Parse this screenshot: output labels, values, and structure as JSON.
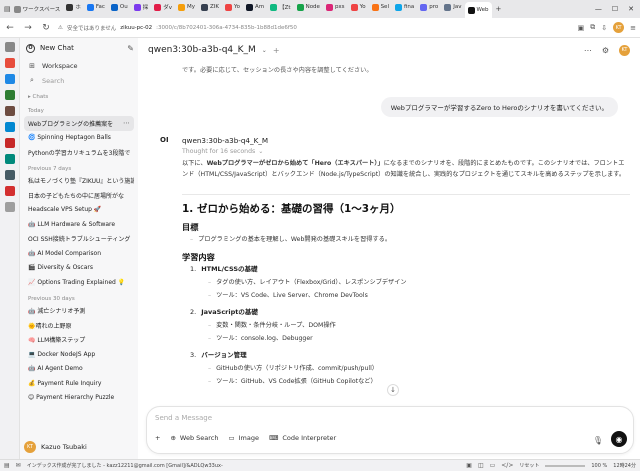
{
  "browser": {
    "workspace_label": "ワークスペース",
    "tabs": [
      {
        "label": "ホ",
        "color": "#333333"
      },
      {
        "label": "Fac",
        "color": "#1877f2"
      },
      {
        "label": "Ou",
        "color": "#0a64c8"
      },
      {
        "label": "採",
        "color": "#7c3aed"
      },
      {
        "label": "ダv",
        "color": "#e11d48"
      },
      {
        "label": "My",
        "color": "#f59e0b"
      },
      {
        "label": "ZIK",
        "color": "#374151"
      },
      {
        "label": "Yo",
        "color": "#ef4444"
      },
      {
        "label": "Am",
        "color": "#111827"
      },
      {
        "label": "【Zt",
        "color": "#10b981"
      },
      {
        "label": "Node",
        "color": "#16a34a"
      },
      {
        "label": "pxs",
        "color": "#db2777"
      },
      {
        "label": "Yo",
        "color": "#ef4444"
      },
      {
        "label": "Sel",
        "color": "#f97316"
      },
      {
        "label": "fina",
        "color": "#0ea5e9"
      },
      {
        "label": "pro",
        "color": "#6366f1"
      },
      {
        "label": "Jav",
        "color": "#64748b"
      },
      {
        "label": "Web",
        "color": "#111111",
        "active": true
      }
    ],
    "url_security": "安全ではありません",
    "url_host": "zikuu-pc-02",
    "url_path": ":3000/c/8b702401-306a-4734-835b-1b88d1de6f50",
    "profile_initials": "KT"
  },
  "sidebar": {
    "new_chat": "New Chat",
    "workspace": "Workspace",
    "search_placeholder": "Search",
    "chats_heading": "Chats",
    "groups": [
      {
        "label": "Today",
        "items": [
          {
            "title": "Webプログラミングの推薦案を",
            "active": true
          },
          {
            "title": "🌀 Spinning Heptagon Balls"
          },
          {
            "title": "Pythonの学習カリキュラムを3段階で"
          }
        ]
      },
      {
        "label": "Previous 7 days",
        "items": [
          {
            "title": "私はモノづくり塾『ZIKUU』という施設"
          },
          {
            "title": "日本の子どもたちの中に居場所がな"
          },
          {
            "title": "Headscale VPS Setup 🚀"
          },
          {
            "title": "🤖 LLM Hardware & Software"
          },
          {
            "title": "OCI SSH接続トラブルシューティング"
          },
          {
            "title": "🤖 AI Model Comparison"
          },
          {
            "title": "🎬 Diversity & Oscars"
          },
          {
            "title": "📈 Options Trading Explained 💡"
          }
        ]
      },
      {
        "label": "Previous 30 days",
        "items": [
          {
            "title": "🤖 減亡シナリオ予測"
          },
          {
            "title": "🌞晴れの上野原"
          },
          {
            "title": "🧠 LLM構築ステップ"
          },
          {
            "title": "💻 Docker NodeJS App"
          },
          {
            "title": "🤖 AI Agent Demo"
          },
          {
            "title": "💰 Payment Rule Inquiry"
          },
          {
            "title": "😊 Payment Hierarchy Puzzle"
          }
        ]
      }
    ],
    "user_initials": "KT",
    "user_name": "Kazuo Tsubaki"
  },
  "main": {
    "model_title": "qwen3:30b-a3b-q4_K_M",
    "prev_assistant_tail": "です。必要に応じて、セッションの長さや内容を調整してください。",
    "user_message": "Webプログラマーが学習するZero to Heroのシナリオを書いてください。",
    "assistant_model": "qwen3:30b-a3b-q4_K_M",
    "thought_label": "Thought for 16 seconds",
    "intro_pre": "以下に、",
    "intro_bold1": "Webプログラマーがゼロから始めて「Hero（エキスパート）」",
    "intro_mid": "になるまでのシナリオを、段階的にまとめたものです。このシナリオでは、フロントエンド（HTML/CSS/JavaScript）とバックエンド（Node.js/TypeScript）の知識を統合し、実践的なプロジェクトを通じてスキルを高めるステップを示します。",
    "h1": "1. ゼロから始める：基礎の習得（1〜3ヶ月）",
    "goal_heading": "目標",
    "goal_item": "プログラミングの基本を理解し、Web開発の基礎スキルを習得する。",
    "content_heading": "学習内容",
    "topics": [
      {
        "num": "1.",
        "title": "HTML/CSSの基礎",
        "items": [
          "タグの使い方、レイアウト（Flexbox/Grid）、レスポンシブデザイン",
          "ツール：VS Code、Live Server、Chrome DevTools"
        ]
      },
      {
        "num": "2.",
        "title": "JavaScriptの基礎",
        "items": [
          "変数・関数・条件分岐・ループ、DOM操作",
          "ツール：console.log、Debugger"
        ]
      },
      {
        "num": "3.",
        "title": "バージョン管理",
        "items": [
          "GitHubの使い方（リポジトリ作成、commit/push/pull）",
          "ツール：GitHub、VS Code拡張（GitHub Copilotなど）"
        ]
      }
    ],
    "composer_placeholder": "Send a Message",
    "tool_web_search": "Web Search",
    "tool_image": "Image",
    "tool_code": "Code Interpreter"
  },
  "statusbar": {
    "message": "インデックス作成が完了しました - kazz12211@gmail.com [Gmail]/&ADLQw33ux-",
    "zoom_label": "リセット",
    "zoom": "100 %",
    "time": "12時24分"
  }
}
